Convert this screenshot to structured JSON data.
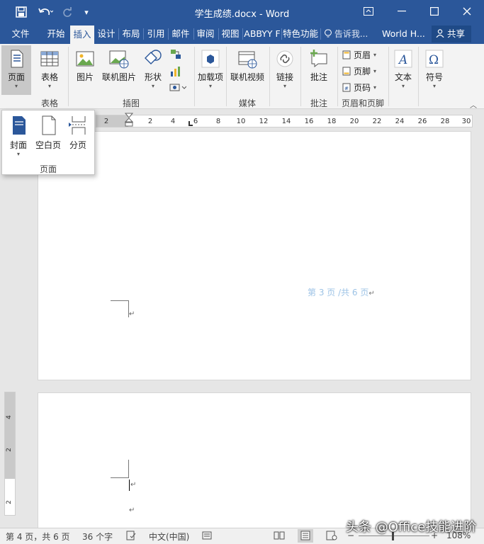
{
  "titlebar": {
    "title": "学生成绩.docx - Word"
  },
  "tabs": {
    "file": "文件",
    "home": "开始",
    "insert": "插入",
    "design": "设计",
    "layout": "布局",
    "references": "引用",
    "mailings": "邮件",
    "review": "审阅",
    "view": "视图",
    "abbyy": "ABBYY F",
    "special": "特色功能",
    "tell_me": "告诉我...",
    "account": "World H...",
    "share": "共享"
  },
  "ribbon": {
    "pages": {
      "label": "页面"
    },
    "tables": {
      "label": "表格",
      "group": "表格"
    },
    "illustrations": {
      "picture": "图片",
      "online_picture": "联机图片",
      "shapes": "形状",
      "group": "插图"
    },
    "addins": {
      "label": "加载项"
    },
    "media": {
      "online_video": "联机视频",
      "group": "媒体"
    },
    "links": {
      "label": "链接"
    },
    "comments": {
      "label": "批注",
      "group": "批注"
    },
    "header_footer": {
      "header": "页眉",
      "footer": "页脚",
      "page_number": "页码",
      "group": "页眉和页脚"
    },
    "text": {
      "label": "文本"
    },
    "symbols": {
      "label": "符号"
    }
  },
  "dropdown": {
    "cover": "封面",
    "blank_page": "空白页",
    "page_break": "分页",
    "group": "页面"
  },
  "ruler": {
    "ticks": [
      "2",
      "2",
      "4",
      "6",
      "8",
      "10",
      "12",
      "14",
      "16",
      "18",
      "20",
      "22",
      "24",
      "26",
      "28",
      "30"
    ]
  },
  "vertical_ruler": {
    "ticks": [
      "4",
      "2",
      "2"
    ]
  },
  "document": {
    "footer_text": "第 3 页 /共 6 页",
    "para_mark": "↵"
  },
  "statusbar": {
    "page": "第 4 页，共 6 页",
    "words": "36 个字",
    "language": "中文(中国)",
    "zoom": "108%"
  },
  "watermark": "头条 @Office技能进阶",
  "colors": {
    "accent": "#2b579a",
    "footer_text": "#9dc3e6"
  }
}
